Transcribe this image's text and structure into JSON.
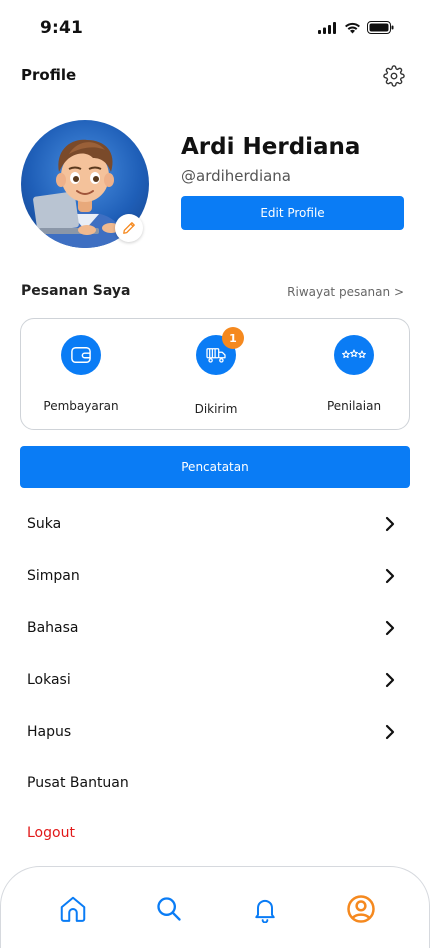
{
  "status_bar": {
    "time": "9:41"
  },
  "header": {
    "title": "Profile"
  },
  "profile": {
    "name": "Ardi Herdiana",
    "handle": "@ardiherdiana",
    "edit_button_label": "Edit Profile"
  },
  "orders": {
    "section_title": "Pesanan Saya",
    "history_link": "Riwayat pesanan >",
    "items": [
      {
        "label": "Pembayaran",
        "icon": "wallet-icon"
      },
      {
        "label": "Dikirim",
        "icon": "truck-icon",
        "badge": "1"
      },
      {
        "label": "Penilaian",
        "icon": "stars-icon"
      }
    ]
  },
  "notes_button": {
    "label": "Pencatatan"
  },
  "menu": {
    "items": [
      {
        "label": "Suka"
      },
      {
        "label": "Simpan"
      },
      {
        "label": "Bahasa"
      },
      {
        "label": "Lokasi"
      },
      {
        "label": "Hapus"
      },
      {
        "label": "Pusat Bantuan"
      },
      {
        "label": "Logout"
      }
    ]
  },
  "bottom_nav": {
    "items": [
      {
        "icon": "home-icon"
      },
      {
        "icon": "search-icon"
      },
      {
        "icon": "bell-icon"
      },
      {
        "icon": "profile-icon",
        "active": true
      }
    ]
  },
  "colors": {
    "primary": "#0a7cf5",
    "accent": "#f5891f",
    "danger": "#e11919"
  }
}
